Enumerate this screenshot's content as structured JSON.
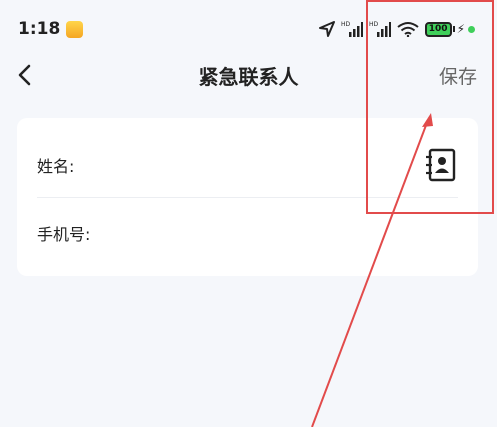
{
  "status_bar": {
    "time": "1:18",
    "notification_icon": "notes-app-icon",
    "network_label_1": "HD",
    "network_label_2": "HD",
    "battery": "100",
    "charging_icon": "bolt-icon",
    "accent_green": "#3fcf5a"
  },
  "nav": {
    "back_icon": "chevron-left-icon",
    "title": "紧急联系人",
    "save_label": "保存"
  },
  "form": {
    "name_label": "姓名:",
    "name_value": "",
    "phone_label": "手机号:",
    "phone_value": "",
    "contacts_icon": "address-book-icon"
  },
  "annotation": {
    "color": "#e24b4b"
  }
}
